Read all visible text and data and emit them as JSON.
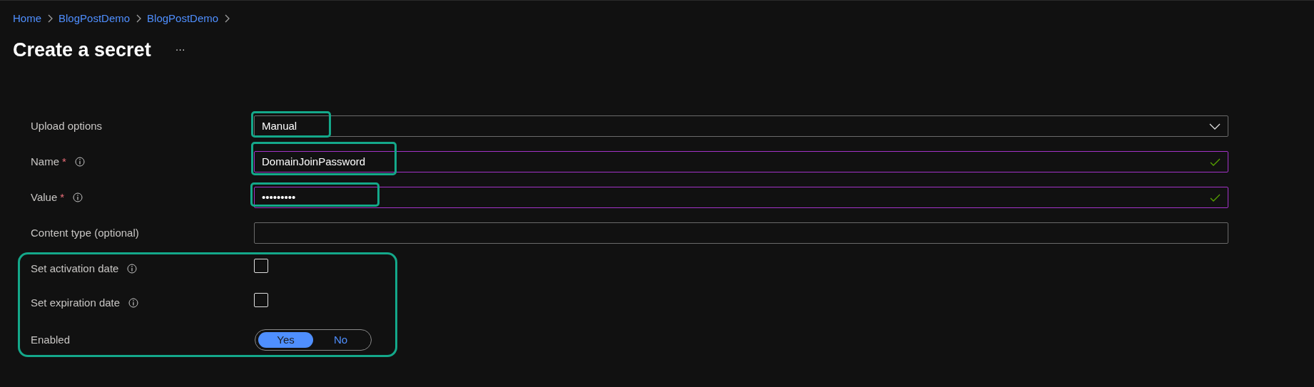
{
  "breadcrumb": [
    "Home",
    "BlogPostDemo",
    "BlogPostDemo"
  ],
  "title": "Create a secret",
  "more_button": "···",
  "fields": [
    {
      "kind": "dropdown",
      "label": "Upload options",
      "info": false,
      "value": "Manual",
      "valid": false
    },
    {
      "kind": "text",
      "label": "Name",
      "required_mark": "*",
      "info": true,
      "value": "DomainJoinPassword",
      "valid": true
    },
    {
      "kind": "text",
      "label": "Value",
      "required_mark": "*",
      "info": true,
      "value": "•••••••••",
      "valid": true
    },
    {
      "kind": "text",
      "label": "Content type (optional)",
      "info": false,
      "valid": false
    },
    {
      "kind": "checkbox",
      "label": "Set activation date",
      "info": true,
      "checked": false
    },
    {
      "kind": "checkbox",
      "label": "Set expiration date",
      "info": true,
      "checked": false
    },
    {
      "kind": "toggle",
      "label": "Enabled",
      "info": false,
      "options": [
        {
          "label": "Yes",
          "selected": true
        },
        {
          "label": "No",
          "selected": false
        }
      ]
    }
  ]
}
